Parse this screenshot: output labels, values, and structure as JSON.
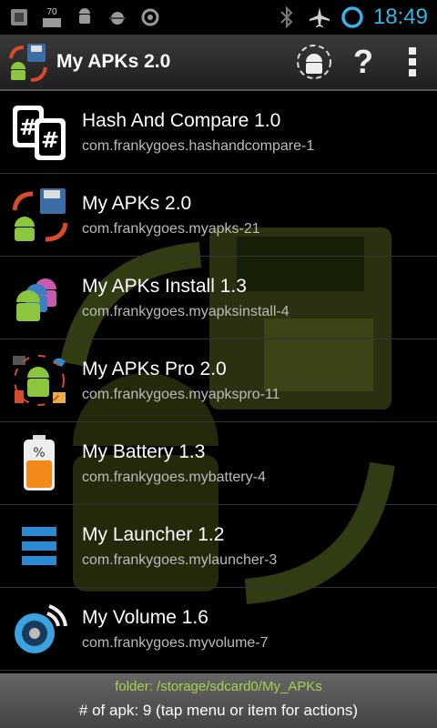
{
  "status_bar": {
    "time": "18:49",
    "notification_badge": "70",
    "icons": [
      "usb-debug-icon",
      "memory-icon",
      "android-icon",
      "android-bug-icon",
      "sync-icon",
      "bluetooth-icon",
      "airplane-mode-icon",
      "battery-ring-icon"
    ]
  },
  "action_bar": {
    "title": "My APKs 2.0",
    "help_label": "?",
    "actions": [
      "apk-manager-icon",
      "help-icon",
      "overflow-menu-icon"
    ]
  },
  "apps": [
    {
      "title": "Hash And Compare 1.0",
      "package": "com.frankygoes.hashandcompare-1",
      "icon": "hash-compare-icon"
    },
    {
      "title": "My APKs 2.0",
      "package": "com.frankygoes.myapks-21",
      "icon": "my-apks-icon"
    },
    {
      "title": "My APKs Install 1.3",
      "package": "com.frankygoes.myapksinstall-4",
      "icon": "apks-install-icon"
    },
    {
      "title": "My APKs Pro 2.0",
      "package": "com.frankygoes.myapkspro-11",
      "icon": "apks-pro-icon"
    },
    {
      "title": "My Battery 1.3",
      "package": "com.frankygoes.mybattery-4",
      "icon": "battery-icon"
    },
    {
      "title": "My Launcher 1.2",
      "package": "com.frankygoes.mylauncher-3",
      "icon": "launcher-icon"
    },
    {
      "title": "My Volume 1.6",
      "package": "com.frankygoes.myvolume-7",
      "icon": "volume-icon"
    }
  ],
  "footer": {
    "folder": "folder: /storage/sdcard0/My_APKs",
    "count": "# of apk: 9   (tap menu or item for actions)"
  },
  "colors": {
    "accent_blue": "#33b5e5",
    "folder_green": "#a7d34a",
    "android_green": "#8cc63f",
    "background": "#000000"
  }
}
